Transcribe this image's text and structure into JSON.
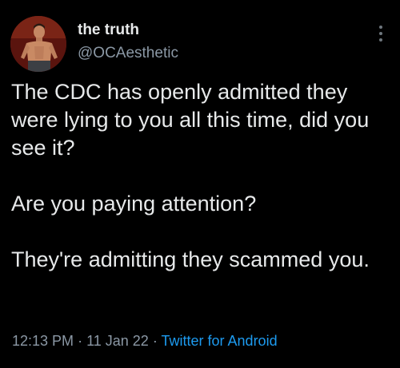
{
  "user": {
    "display_name": "the truth",
    "handle": "@OCAesthetic"
  },
  "tweet": {
    "paragraphs": [
      "The CDC has openly admitted they were lying to you all this time, did you see it?",
      "Are you paying attention?",
      "They're admitting they scammed you."
    ],
    "time": "12:13 PM",
    "separator": "·",
    "date": "11 Jan 22",
    "source": "Twitter for Android"
  },
  "icons": {
    "more": "more-options-icon",
    "avatar": "avatar"
  },
  "colors": {
    "background": "#000000",
    "text": "#e7e9ea",
    "secondary_text": "#8b98a5",
    "link": "#1d9bf0"
  }
}
